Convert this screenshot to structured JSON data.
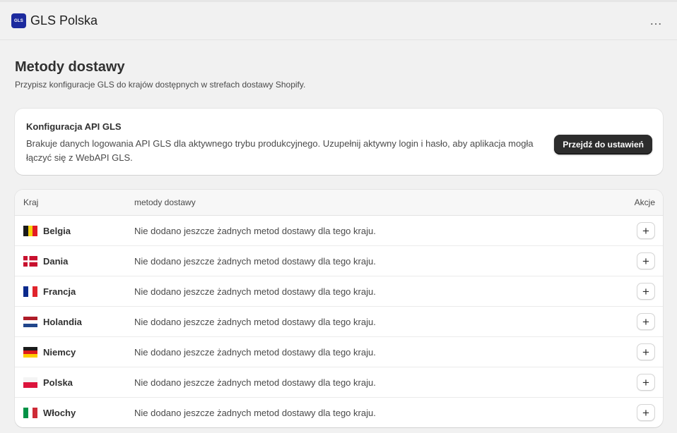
{
  "app": {
    "logo_text": "GLS",
    "title": "GLS Polska",
    "menu_icon": "…"
  },
  "page": {
    "title": "Metody dostawy",
    "subtitle": "Przypisz konfiguracje GLS do krajów dostępnych w strefach dostawy Shopify."
  },
  "api_card": {
    "title": "Konfiguracja API GLS",
    "description": "Brakuje danych logowania API GLS dla aktywnego trybu produkcyjnego. Uzupełnij aktywny login i hasło, aby aplikacja mogła łączyć się z WebAPI GLS.",
    "button_label": "Przejdź do ustawień"
  },
  "table": {
    "headers": {
      "country": "Kraj",
      "methods": "metody dostawy",
      "actions": "Akcje"
    },
    "add_label": "+",
    "rows": [
      {
        "country": "Belgia",
        "flag": "flag-be-icon",
        "methods": "Nie dodano jeszcze żadnych metod dostawy dla tego kraju."
      },
      {
        "country": "Dania",
        "flag": "flag-dk-icon",
        "methods": "Nie dodano jeszcze żadnych metod dostawy dla tego kraju."
      },
      {
        "country": "Francja",
        "flag": "flag-fr-icon",
        "methods": "Nie dodano jeszcze żadnych metod dostawy dla tego kraju."
      },
      {
        "country": "Holandia",
        "flag": "flag-nl-icon",
        "methods": "Nie dodano jeszcze żadnych metod dostawy dla tego kraju."
      },
      {
        "country": "Niemcy",
        "flag": "flag-de-icon",
        "methods": "Nie dodano jeszcze żadnych metod dostawy dla tego kraju."
      },
      {
        "country": "Polska",
        "flag": "flag-pl-icon",
        "methods": "Nie dodano jeszcze żadnych metod dostawy dla tego kraju."
      },
      {
        "country": "Włochy",
        "flag": "flag-it-icon",
        "methods": "Nie dodano jeszcze żadnych metod dostawy dla tego kraju."
      }
    ]
  },
  "colors": {
    "logo_bg": "#1c2a9e",
    "primary_button": "#2c2c2c",
    "page_bg": "#f1f1f1"
  }
}
